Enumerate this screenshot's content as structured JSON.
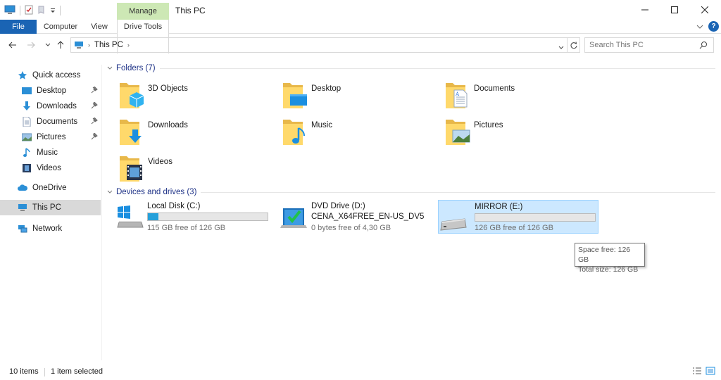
{
  "window": {
    "title": "This PC",
    "context_tab": "Manage"
  },
  "ribbon": {
    "tabs": [
      "File",
      "Computer",
      "View",
      "Drive Tools"
    ]
  },
  "address": {
    "path": "This PC",
    "search_placeholder": "Search This PC"
  },
  "sidebar": {
    "quick_access": "Quick access",
    "items": [
      "Desktop",
      "Downloads",
      "Documents",
      "Pictures",
      "Music",
      "Videos"
    ],
    "onedrive": "OneDrive",
    "this_pc": "This PC",
    "network": "Network"
  },
  "folders": {
    "header": "Folders (7)",
    "items": [
      "3D Objects",
      "Desktop",
      "Documents",
      "Downloads",
      "Music",
      "Pictures",
      "Videos"
    ]
  },
  "drives": {
    "header": "Devices and drives (3)",
    "items": [
      {
        "name": "Local Disk (C:)",
        "free": "115 GB free of 126 GB",
        "used_fraction": 0.087
      },
      {
        "name": "DVD Drive (D:)",
        "label": "CENA_X64FREE_EN-US_DV5",
        "free": "0 bytes free of 4,30 GB"
      },
      {
        "name": "MIRROR (E:)",
        "free": "126 GB free of 126 GB",
        "used_fraction": 0.0
      }
    ]
  },
  "tooltip": {
    "line1": "Space free: 126 GB",
    "line2": "Total size: 126 GB"
  },
  "status": {
    "items": "10 items",
    "selected": "1 item selected"
  },
  "colors": {
    "accent": "#1a64b4",
    "manage": "#cde8b5",
    "selection": "#cce8ff",
    "progress": "#26a0da",
    "header_text": "#1e3287"
  }
}
